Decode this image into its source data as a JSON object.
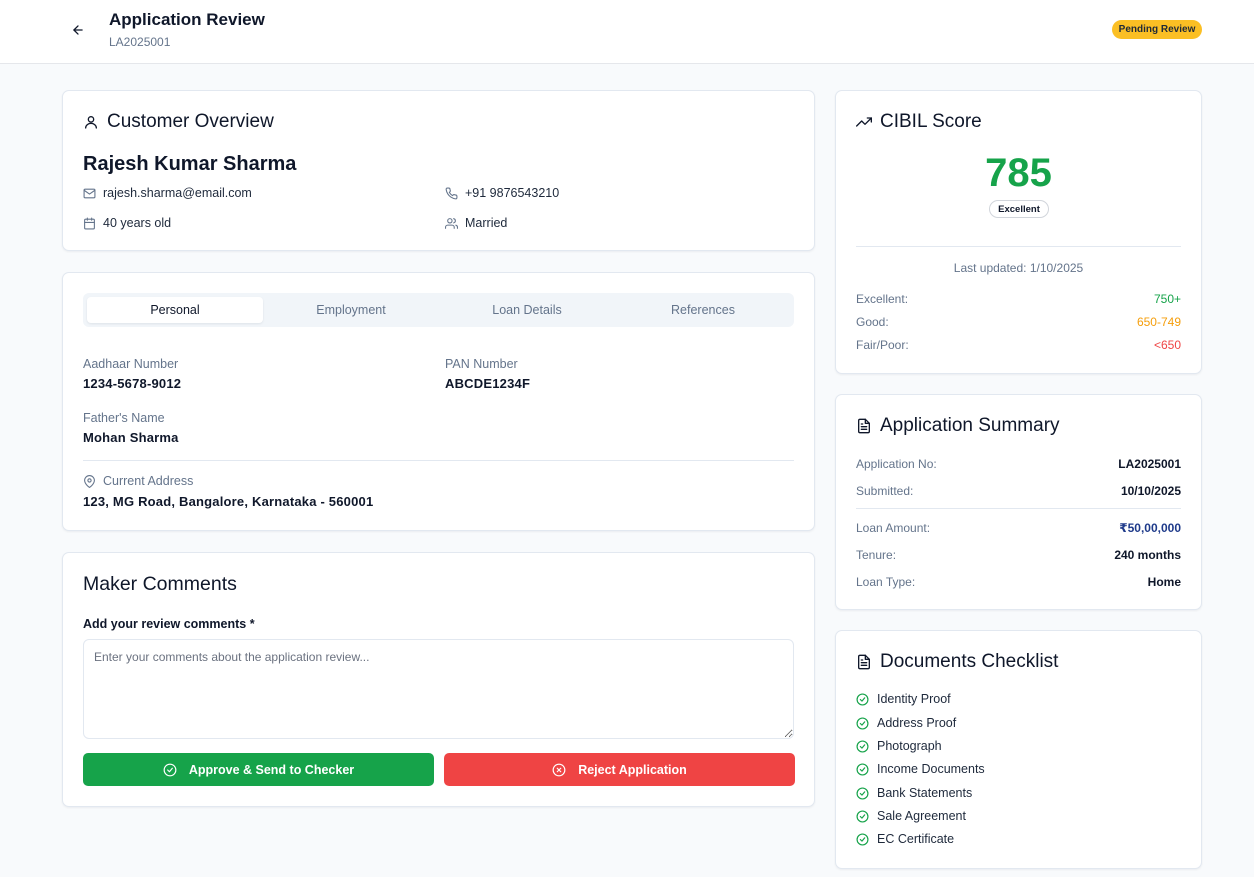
{
  "header": {
    "title": "Application Review",
    "application_id": "LA2025001",
    "status": "Pending Review",
    "status_color": "#fbbf24"
  },
  "customer": {
    "section_title": "Customer Overview",
    "name": "Rajesh Kumar Sharma",
    "email": "rajesh.sharma@email.com",
    "phone": "+91 9876543210",
    "age": "40 years old",
    "marital_status": "Married"
  },
  "tabs": [
    {
      "label": "Personal",
      "active": true
    },
    {
      "label": "Employment",
      "active": false
    },
    {
      "label": "Loan Details",
      "active": false
    },
    {
      "label": "References",
      "active": false
    }
  ],
  "personal": {
    "aadhaar_label": "Aadhaar Number",
    "aadhaar_value": "1234-5678-9012",
    "pan_label": "PAN Number",
    "pan_value": "ABCDE1234F",
    "father_label": "Father's Name",
    "father_value": "Mohan Sharma",
    "address_label": "Current Address",
    "address_value": "123, MG Road, Bangalore, Karnataka - 560001"
  },
  "comments": {
    "title": "Maker Comments",
    "label": "Add your review comments *",
    "placeholder": "Enter your comments about the application review...",
    "value": "",
    "approve_label": "Approve & Send to Checker",
    "reject_label": "Reject Application",
    "approve_color": "#16a34a",
    "reject_color": "#ef4444"
  },
  "cibil": {
    "title": "CIBIL Score",
    "score": "785",
    "rating": "Excellent",
    "last_updated": "Last updated: 1/10/2025",
    "ranges": [
      {
        "label": "Excellent:",
        "value": "750+",
        "color": "#16a34a"
      },
      {
        "label": "Good:",
        "value": "650-749",
        "color": "#f59e0b"
      },
      {
        "label": "Fair/Poor:",
        "value": "<650",
        "color": "#ef4444"
      }
    ]
  },
  "summary": {
    "title": "Application Summary",
    "rows": [
      {
        "label": "Application No:",
        "value": "LA2025001"
      },
      {
        "label": "Submitted:",
        "value": "10/10/2025"
      },
      {
        "label": "Loan Amount:",
        "value": "₹50,00,000"
      },
      {
        "label": "Tenure:",
        "value": "240 months"
      },
      {
        "label": "Loan Type:",
        "value": "Home"
      }
    ]
  },
  "documents": {
    "title": "Documents Checklist",
    "items": [
      "Identity Proof",
      "Address Proof",
      "Photograph",
      "Income Documents",
      "Bank Statements",
      "Sale Agreement",
      "EC Certificate"
    ]
  }
}
